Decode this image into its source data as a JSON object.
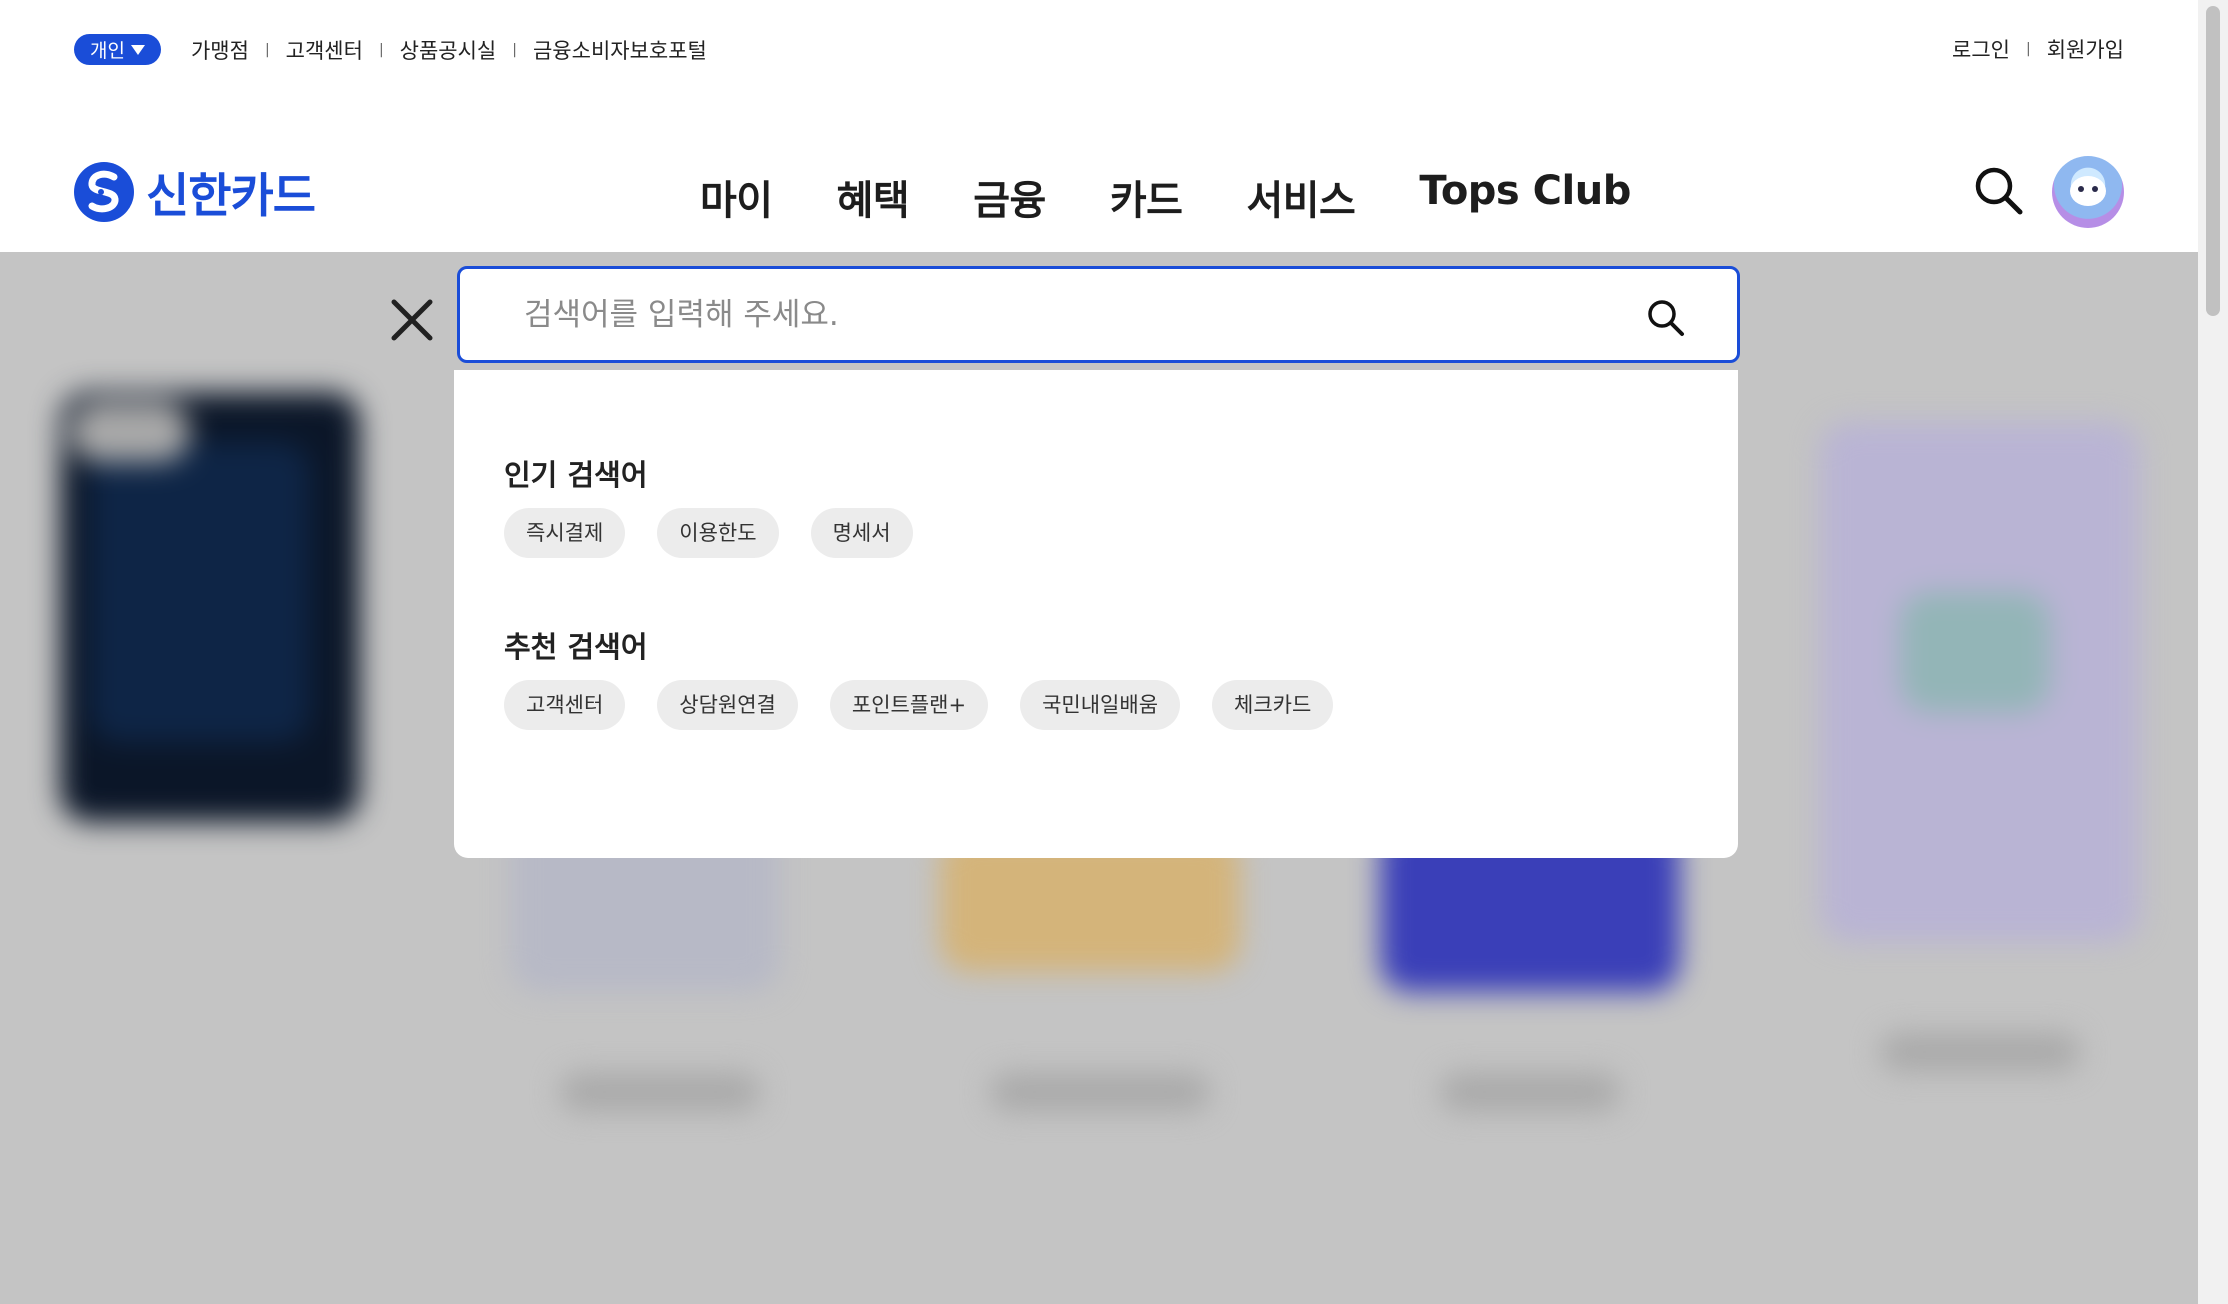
{
  "header": {
    "segment": "개인",
    "util_links": [
      "가맹점",
      "고객센터",
      "상품공시실",
      "금융소비자보호포털"
    ],
    "auth": {
      "login": "로그인",
      "signup": "회원가입"
    },
    "logo_text": "신한카드",
    "brand_color": "#1a4dd8",
    "nav": [
      "마이",
      "혜택",
      "금융",
      "카드",
      "서비스",
      "Tops Club"
    ]
  },
  "search": {
    "placeholder": "검색어를 입력해 주세요.",
    "popular": {
      "title": "인기 검색어",
      "terms": [
        "즉시결제",
        "이용한도",
        "명세서"
      ]
    },
    "recommended": {
      "title": "추천 검색어",
      "terms": [
        "고객센터",
        "상담원연결",
        "포인트플랜+",
        "국민내일배움",
        "체크카드"
      ]
    }
  },
  "icons": [
    "caret-down-icon",
    "search-icon",
    "close-icon",
    "avatar-icon",
    "shinhan-logo-icon"
  ]
}
